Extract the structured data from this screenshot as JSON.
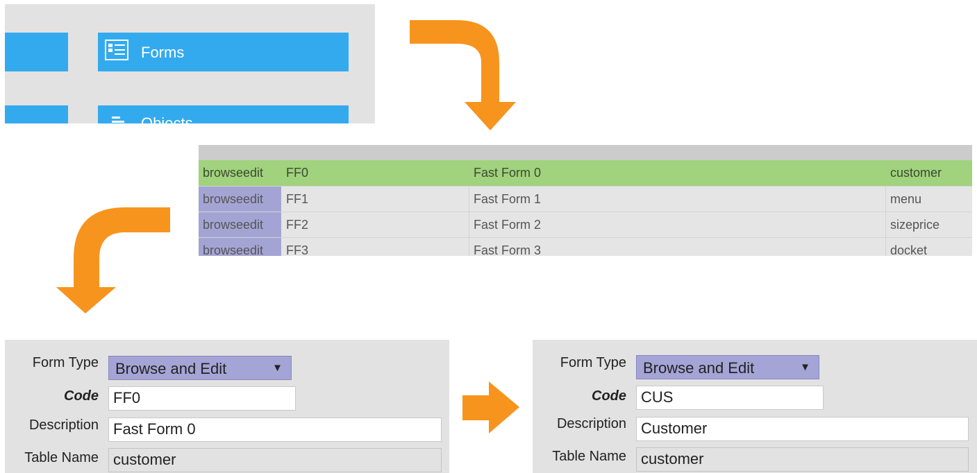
{
  "tiles": {
    "forms_label": "Forms",
    "objects_label": "Objects"
  },
  "list": {
    "rows": [
      {
        "type": "browseedit",
        "code": "FF0",
        "description": "Fast Form 0",
        "table": "customer"
      },
      {
        "type": "browseedit",
        "code": "FF1",
        "description": "Fast Form 1",
        "table": "menu"
      },
      {
        "type": "browseedit",
        "code": "FF2",
        "description": "Fast Form 2",
        "table": "sizeprice"
      },
      {
        "type": "browseedit",
        "code": "FF3",
        "description": "Fast Form 3",
        "table": "docket"
      }
    ]
  },
  "form_before": {
    "form_type_label": "Form Type",
    "form_type_value": "Browse and Edit",
    "code_label": "Code",
    "code_value": "FF0",
    "description_label": "Description",
    "description_value": "Fast Form 0",
    "table_label": "Table Name",
    "table_value": "customer"
  },
  "form_after": {
    "form_type_label": "Form Type",
    "form_type_value": "Browse and Edit",
    "code_label": "Code",
    "code_value": "CUS",
    "description_label": "Description",
    "description_value": "Customer",
    "table_label": "Table Name",
    "table_value": "customer"
  },
  "colors": {
    "tile_blue": "#33aaee",
    "arrow_orange": "#f7941d",
    "selected_row": "#a1d27d",
    "type_cell": "#a4a4d4",
    "select_bg": "#a4a4d6"
  },
  "icons": {
    "forms": "form-list-icon",
    "objects": "objects-icon",
    "dropdown": "caret-down-icon",
    "arrows": "orange-flow-arrow"
  }
}
